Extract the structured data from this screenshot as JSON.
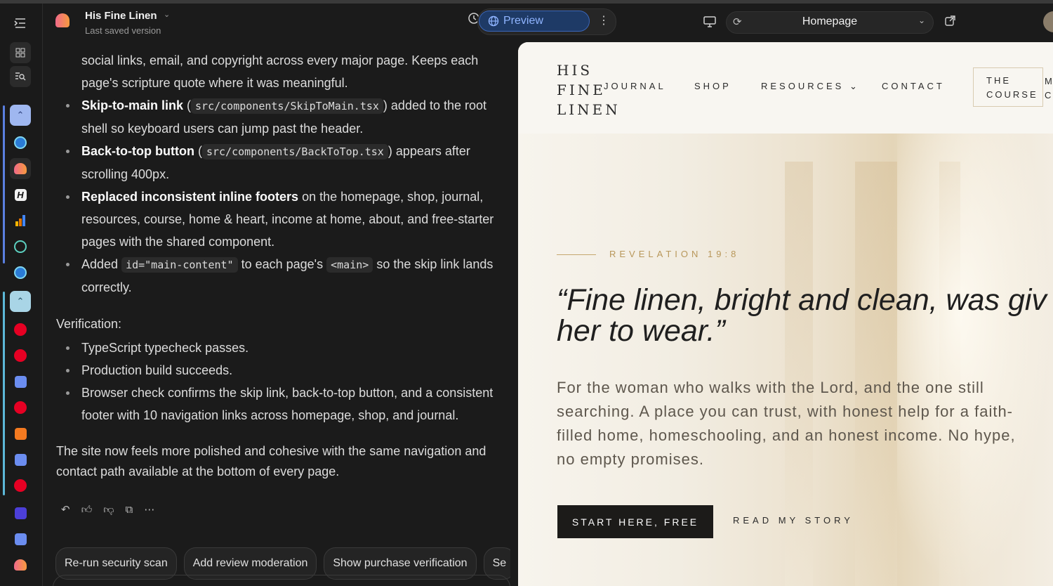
{
  "project": {
    "title": "His Fine Linen",
    "subtitle": "Last saved version"
  },
  "toolbar": {
    "preview_label": "Preview",
    "page_select": "Homepage"
  },
  "chat": {
    "intro_line1": "social links, email, and copyright across every major page. Keeps each",
    "intro_line2": "page's scripture quote where it was meaningful.",
    "bullets": {
      "skip_bold": "Skip-to-main link",
      "skip_code": "src/components/SkipToMain.tsx",
      "skip_text": " added to the root shell so keyboard users can jump past the header.",
      "top_bold": "Back-to-top button",
      "top_code": "src/components/BackToTop.tsx",
      "top_text": " appears after scrolling 400px.",
      "footer_bold": "Replaced inconsistent inline footers",
      "footer_text": " on the homepage, shop, journal, resources, course, home & heart, income at home, about, and free-starter pages with the shared component.",
      "added_a": "Added ",
      "added_code1": "id=\"main-content\"",
      "added_b": " to each page's ",
      "added_code2": "<main>",
      "added_c": " so the skip link lands correctly."
    },
    "verification_title": "Verification:",
    "verification": [
      "TypeScript typecheck passes.",
      "Production build succeeds.",
      "Browser check confirms the skip link, back-to-top button, and a consistent footer with 10 navigation links across homepage, shop, and journal."
    ],
    "summary": "The site now feels more polished and cohesive with the same navigation and contact path available at the bottom of every page.",
    "suggestions": [
      "Re-run security scan",
      "Add review moderation",
      "Show purchase verification",
      "Se"
    ]
  },
  "site": {
    "brand_lines": [
      "HIS",
      "FINE",
      "LINEN"
    ],
    "nav": {
      "journal": "JOURNAL",
      "shop": "SHOP",
      "resources": "RESOURCES",
      "contact": "CONTACT"
    },
    "course_line1": "THE",
    "course_line2": "COURSE",
    "clip_line1": "M",
    "clip_line2": "C",
    "eyebrow": "REVELATION 19:8",
    "quote_line1": "“Fine linen, bright and clean, was giv",
    "quote_line2": "her to wear.”",
    "lead": "For the woman who walks with the Lord, and the one still searching. A place you can trust, with honest help for a faith-filled home, homeschooling, and an honest income. No hype, no empty promises.",
    "cta_primary": "START HERE, FREE",
    "cta_secondary": "READ MY STORY"
  },
  "colors": {
    "accent_blue": "#3b66b8",
    "gold": "#b8975a",
    "dark_bg": "#1b1b1b"
  }
}
